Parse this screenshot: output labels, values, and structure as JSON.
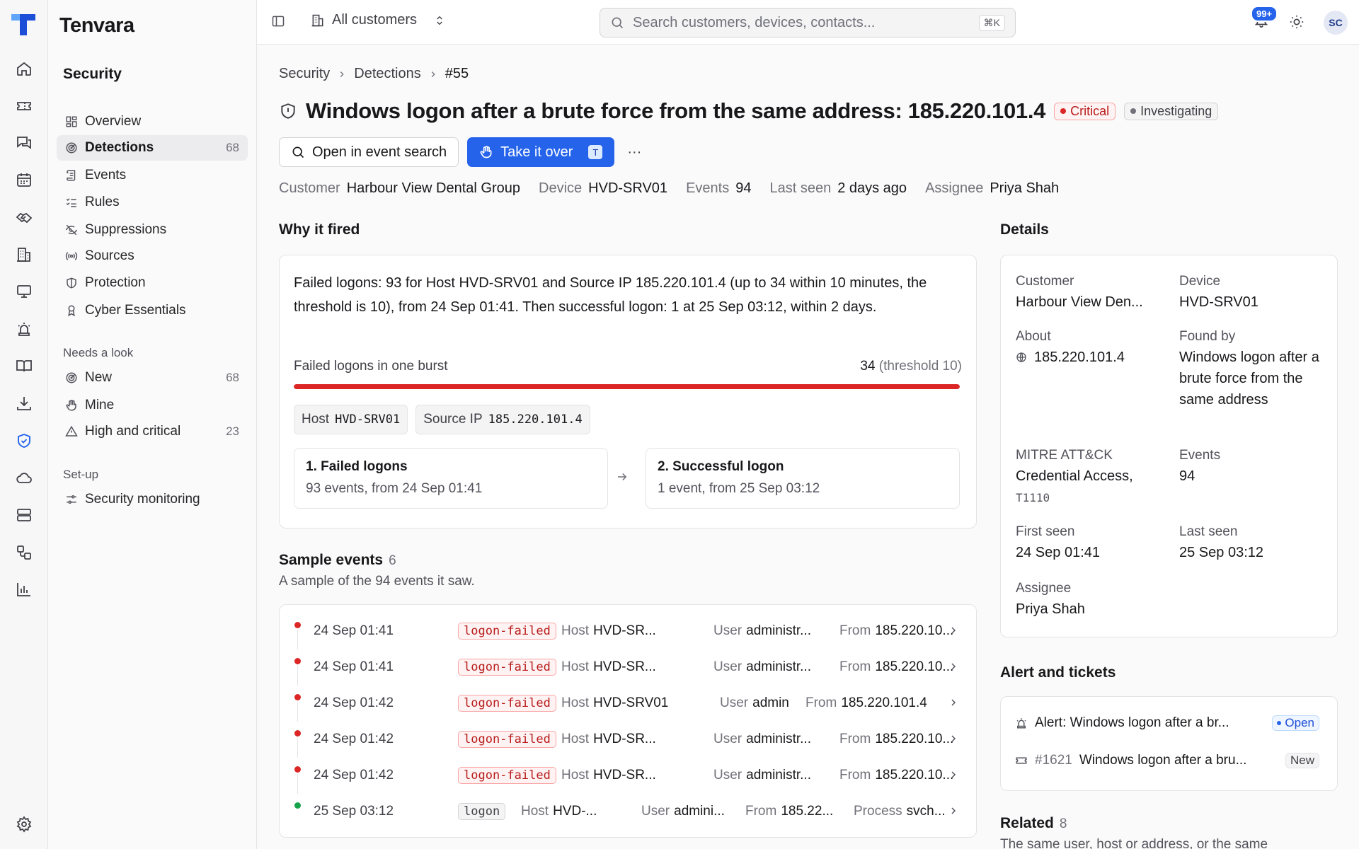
{
  "rail": {
    "icons": [
      "home-icon",
      "ticket-icon",
      "messages-icon",
      "calendar-icon",
      "handshake-icon",
      "building-icon",
      "monitor-icon",
      "siren-icon",
      "book-icon",
      "download-icon",
      "shield-icon",
      "cloud-icon",
      "server-icon",
      "workflow-icon",
      "chart-icon",
      "settings-icon"
    ]
  },
  "sidebar": {
    "brand": "Tenvara",
    "section": "Security",
    "items": [
      {
        "label": "Overview",
        "icon": "layout-grid-icon"
      },
      {
        "label": "Detections",
        "icon": "radar-icon",
        "count": "68",
        "active": true
      },
      {
        "label": "Events",
        "icon": "scroll-icon"
      },
      {
        "label": "Rules",
        "icon": "list-checks-icon"
      },
      {
        "label": "Suppressions",
        "icon": "eye-off-icon"
      },
      {
        "label": "Sources",
        "icon": "radio-icon"
      },
      {
        "label": "Protection",
        "icon": "shield-half-icon"
      },
      {
        "label": "Cyber Essentials",
        "icon": "award-icon"
      }
    ],
    "group1": "Needs a look",
    "look": [
      {
        "label": "New",
        "icon": "radar-icon",
        "count": "68"
      },
      {
        "label": "Mine",
        "icon": "hand-icon"
      },
      {
        "label": "High and critical",
        "icon": "alert-triangle-icon",
        "count": "23"
      }
    ],
    "group2": "Set-up",
    "setup": [
      {
        "label": "Security monitoring",
        "icon": "sliders-icon"
      }
    ]
  },
  "topbar": {
    "customer_scope": "All customers",
    "search_placeholder": "Search customers, devices, contacts...",
    "shortcut": "⌘K",
    "notifications": "99+",
    "avatar": "SC"
  },
  "breadcrumb": [
    "Security",
    "Detections",
    "#55"
  ],
  "detection": {
    "title": "Windows logon after a brute force from the same address: 185.220.101.4",
    "severity": "Critical",
    "status": "Investigating",
    "actions": {
      "open_search": "Open in event search",
      "take_over": "Take it over",
      "take_over_key": "T",
      "more": "···"
    },
    "meta": [
      {
        "k": "Customer",
        "v": "Harbour View Dental Group"
      },
      {
        "k": "Device",
        "v": "HVD-SRV01"
      },
      {
        "k": "Events",
        "v": "94"
      },
      {
        "k": "Last seen",
        "v": "2 days ago"
      },
      {
        "k": "Assignee",
        "v": "Priya Shah"
      }
    ]
  },
  "why": {
    "heading": "Why it fired",
    "text": "Failed logons: 93 for Host HVD-SRV01 and Source IP 185.220.101.4 (up to 34 within 10 minutes, the threshold is 10), from 24 Sep 01:41. Then successful logon: 1 at 25 Sep 03:12, within 2 days.",
    "burst_label": "Failed logons in one burst",
    "burst_value": "34",
    "burst_threshold": "(threshold 10)",
    "burst_fill": 1.0,
    "chips": [
      {
        "k": "Host",
        "v": "HVD-SRV01"
      },
      {
        "k": "Source IP",
        "v": "185.220.101.4"
      }
    ],
    "steps": [
      {
        "title": "1. Failed logons",
        "sub": "93 events, from 24 Sep 01:41"
      },
      {
        "title": "2. Successful logon",
        "sub": "1 event, from 25 Sep 03:12"
      }
    ]
  },
  "samples": {
    "heading": "Sample events",
    "count": "6",
    "sub": "A sample of the 94 events it saw.",
    "rows": [
      {
        "time": "24 Sep 01:41",
        "tag": "logon-failed",
        "host": "HVD-SR...",
        "user": "administr...",
        "from": "185.220.10..."
      },
      {
        "time": "24 Sep 01:41",
        "tag": "logon-failed",
        "host": "HVD-SR...",
        "user": "administr...",
        "from": "185.220.10..."
      },
      {
        "time": "24 Sep 01:42",
        "tag": "logon-failed",
        "host": "HVD-SRV01",
        "user": "admin",
        "from": "185.220.101.4"
      },
      {
        "time": "24 Sep 01:42",
        "tag": "logon-failed",
        "host": "HVD-SR...",
        "user": "administr...",
        "from": "185.220.10..."
      },
      {
        "time": "24 Sep 01:42",
        "tag": "logon-failed",
        "host": "HVD-SR...",
        "user": "administr...",
        "from": "185.220.10..."
      },
      {
        "time": "25 Sep 03:12",
        "tag": "logon",
        "host": "HVD-...",
        "user": "admini...",
        "from": "185.22...",
        "process": "svch..."
      }
    ],
    "labels": {
      "host": "Host",
      "user": "User",
      "from": "From",
      "process": "Process"
    }
  },
  "details": {
    "heading": "Details",
    "customer_l": "Customer",
    "customer_v": "Harbour View Den...",
    "device_l": "Device",
    "device_v": "HVD-SRV01",
    "about_l": "About",
    "about_v": "185.220.101.4",
    "found_l": "Found by",
    "found_v": "Windows logon after a brute force from the same address",
    "mitre_l": "MITRE ATT&CK",
    "mitre_v": "Credential Access,",
    "mitre_id": "T1110",
    "events_l": "Events",
    "events_v": "94",
    "first_l": "First seen",
    "first_v": "24 Sep 01:41",
    "last_l": "Last seen",
    "last_v": "25 Sep 03:12",
    "assignee_l": "Assignee",
    "assignee_v": "Priya Shah"
  },
  "alerts": {
    "heading": "Alert and tickets",
    "alert_text": "Alert: Windows logon after a br...",
    "alert_status": "Open",
    "ticket_id": "#1621",
    "ticket_text": "Windows logon after a bru...",
    "ticket_status": "New"
  },
  "related": {
    "heading": "Related",
    "count": "8",
    "sub": "The same user, host or address, or the same"
  },
  "colors": {
    "accent": "#2563eb",
    "critical": "#dc2626",
    "success": "#16a34a"
  }
}
